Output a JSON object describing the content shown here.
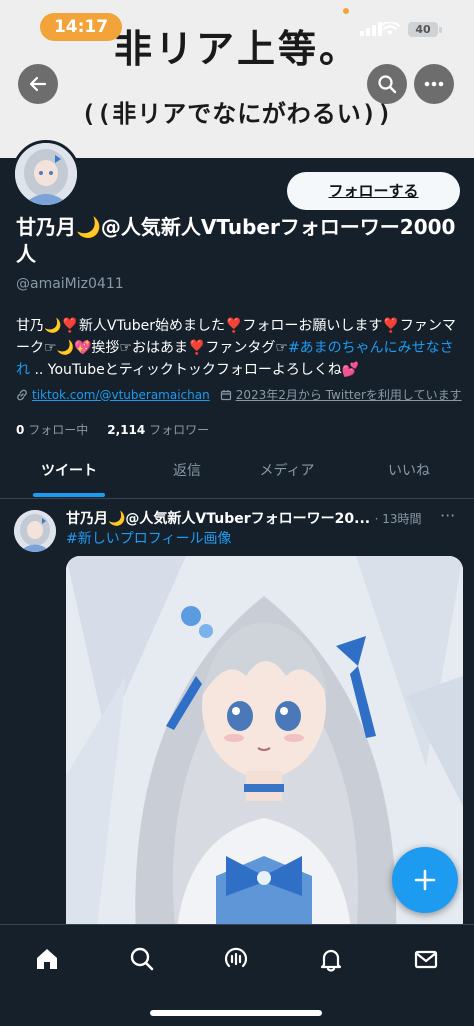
{
  "status_bar": {
    "time": "14:17",
    "battery": "40"
  },
  "banner": {
    "line1": "非リア上等。",
    "line2": "((非リアでなにがわるい))"
  },
  "profile": {
    "follow_button": "フォローする",
    "display_name": "甘乃月🌙@人気新人VTuberフォローワー2000人",
    "handle": "@amaiMiz0411",
    "bio_part1": "甘乃🌙❣️新人VTuber始めました❣️フォローお願いします❣️ファンマーク☞🌙💖挨拶☞おはあま❣️ファンタグ☞",
    "bio_hashtag": "#あまのちゃんにみせなされ",
    "bio_part2": " .. YouTubeとティックトックフォローよろしくね💕",
    "link": "tiktok.com/@vtuberamaichan",
    "joined": "2023年2月から Twitterを利用しています",
    "following_count": "0",
    "following_label": "フォロー中",
    "followers_count": "2,114",
    "followers_label": "フォロワー"
  },
  "tabs": [
    {
      "label": "ツイート"
    },
    {
      "label": "返信"
    },
    {
      "label": "メディア"
    },
    {
      "label": "いいね"
    }
  ],
  "tweet": {
    "name": "甘乃月🌙@人気新人VTuberフォローワー20...",
    "time": "· 13時間",
    "more": "···",
    "hashtag": "#新しいプロフィール画像"
  },
  "icons": {
    "back": "arrow-left-icon",
    "search": "search-icon",
    "more": "more-icon",
    "fab": "plus-icon",
    "nav": [
      "home-icon",
      "search-icon",
      "spaces-icon",
      "notifications-icon",
      "messages-icon"
    ]
  },
  "colors": {
    "background": "#15202b",
    "accent": "#1d9bf0",
    "muted": "#8899a6",
    "time_pill": "#f2a33a"
  }
}
